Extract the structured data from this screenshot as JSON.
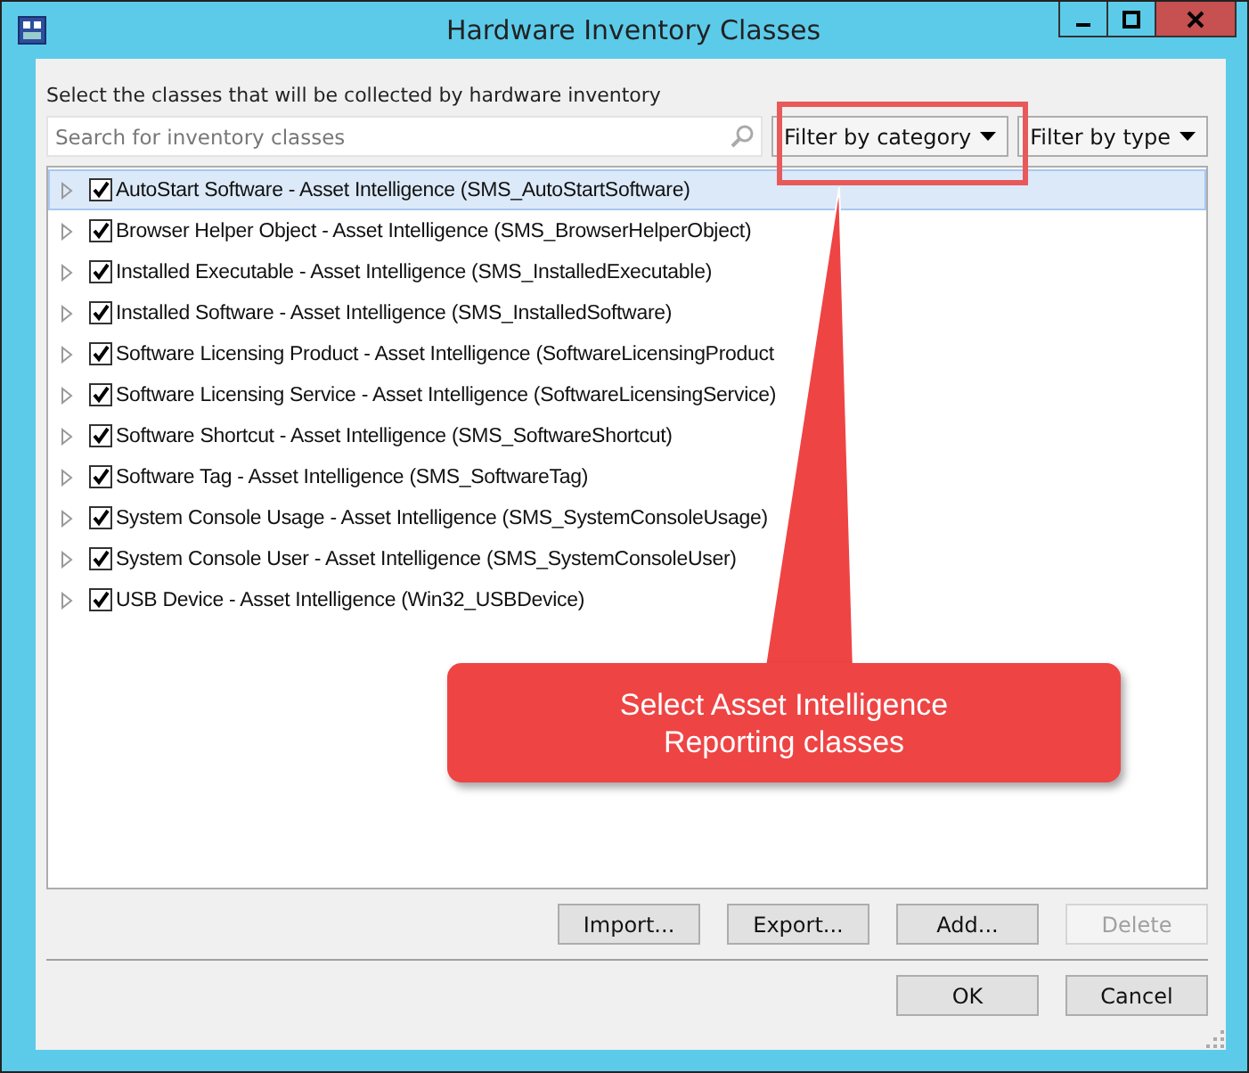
{
  "window": {
    "title": "Hardware Inventory Classes"
  },
  "instruction": "Select the classes that will be collected by hardware inventory",
  "search": {
    "placeholder": "Search for inventory classes"
  },
  "filters": [
    "Filter by category",
    "Filter by type"
  ],
  "classes": [
    {
      "label": "AutoStart Software - Asset Intelligence (SMS_AutoStartSoftware)",
      "checked": true,
      "selected": true
    },
    {
      "label": "Browser Helper Object - Asset Intelligence (SMS_BrowserHelperObject)",
      "checked": true,
      "selected": false
    },
    {
      "label": "Installed Executable - Asset Intelligence (SMS_InstalledExecutable)",
      "checked": true,
      "selected": false
    },
    {
      "label": "Installed Software - Asset Intelligence (SMS_InstalledSoftware)",
      "checked": true,
      "selected": false
    },
    {
      "label": "Software Licensing Product - Asset Intelligence (SoftwareLicensingProduct",
      "checked": true,
      "selected": false
    },
    {
      "label": "Software Licensing Service - Asset Intelligence (SoftwareLicensingService)",
      "checked": true,
      "selected": false
    },
    {
      "label": "Software Shortcut - Asset Intelligence (SMS_SoftwareShortcut)",
      "checked": true,
      "selected": false
    },
    {
      "label": "Software Tag - Asset Intelligence (SMS_SoftwareTag)",
      "checked": true,
      "selected": false
    },
    {
      "label": "System Console Usage - Asset Intelligence (SMS_SystemConsoleUsage)",
      "checked": true,
      "selected": false
    },
    {
      "label": "System Console User - Asset Intelligence (SMS_SystemConsoleUser)",
      "checked": true,
      "selected": false
    },
    {
      "label": "USB Device - Asset Intelligence (Win32_USBDevice)",
      "checked": true,
      "selected": false
    }
  ],
  "actions": [
    {
      "label": "Import...",
      "disabled": false
    },
    {
      "label": "Export...",
      "disabled": false
    },
    {
      "label": "Add...",
      "disabled": false
    },
    {
      "label": "Delete",
      "disabled": true
    }
  ],
  "dialog_buttons": [
    "OK",
    "Cancel"
  ],
  "callout": {
    "lines": [
      "Select Asset Intelligence",
      "Reporting classes"
    ]
  }
}
